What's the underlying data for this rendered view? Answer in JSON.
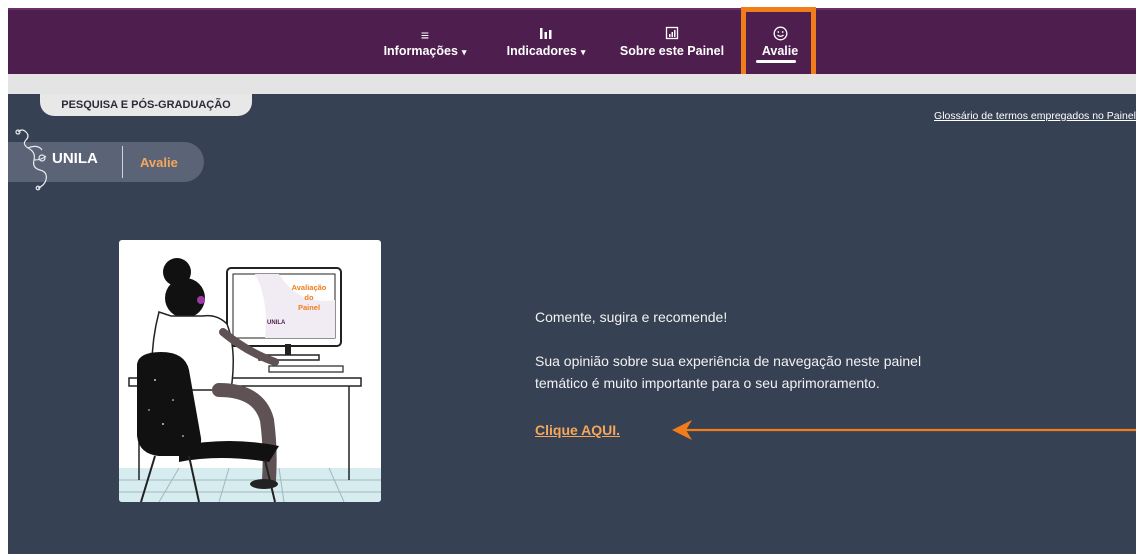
{
  "nav": {
    "items": [
      {
        "icon": "list-icon",
        "label": "Informações",
        "has_caret": true
      },
      {
        "icon": "bar-chart-icon",
        "label": "Indicadores",
        "has_caret": true
      },
      {
        "icon": "report-icon",
        "label": "Sobre este Painel",
        "has_caret": false
      },
      {
        "icon": "smile-icon",
        "label": "Avalie",
        "has_caret": false,
        "active": true
      }
    ],
    "caret": "▾"
  },
  "section_tab": "PESQUISA E PÓS-GRADUAÇÃO",
  "glossary_link": "Glossário de termos empregados no Painel",
  "brand": {
    "name": "UNILA",
    "page": "Avalie"
  },
  "illustration": {
    "screen_title_line1": "Avaliação",
    "screen_title_line2": "do",
    "screen_title_line3": "Painel",
    "screen_logo": "UNILA"
  },
  "message": {
    "title": "Comente, sugira e recomende!",
    "body": "Sua opinião sobre sua experiência de navegação neste painel temático é muito importante para o seu aprimoramento.",
    "cta": "Clique AQUI."
  },
  "colors": {
    "nav_bg": "#4e1f4e",
    "panel_bg": "#374154",
    "accent_orange": "#f07d1a",
    "link_orange": "#f5a65b"
  }
}
